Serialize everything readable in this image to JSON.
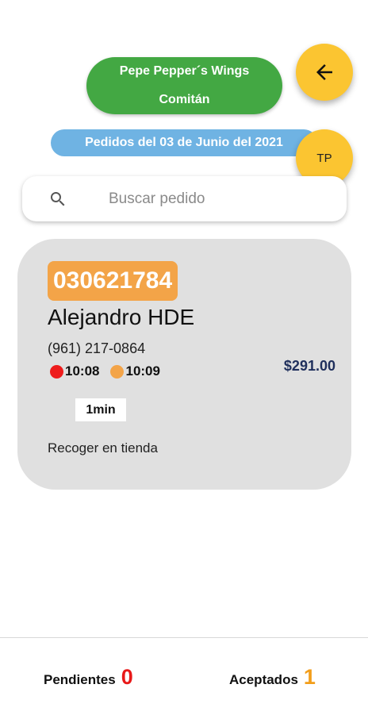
{
  "header": {
    "store_name": "Pepe Pepper´s Wings",
    "store_city": "Comitán",
    "date_label": "Pedidos del 03 de Junio del 2021",
    "user_initials": "TP",
    "back_icon": "arrow-left-icon"
  },
  "search": {
    "placeholder": "Buscar pedido",
    "icon": "search-icon"
  },
  "order": {
    "id": "030621784",
    "customer": "Alejandro HDE",
    "phone": "(961) 217-0864",
    "time_received": "10:08",
    "time_accepted": "10:09",
    "price": "$291.00",
    "elapsed": "1min",
    "delivery_type": "Recoger en tienda"
  },
  "tabs": {
    "pending_label": "Pendientes",
    "pending_count": "0",
    "accepted_label": "Aceptados",
    "accepted_count": "1"
  },
  "colors": {
    "store_pill": "#43a843",
    "date_pill": "#6fb3e3",
    "fab": "#fbc531",
    "order_id_bg": "#f3a448",
    "pending": "#e81919",
    "accepted": "#f29e1b"
  }
}
